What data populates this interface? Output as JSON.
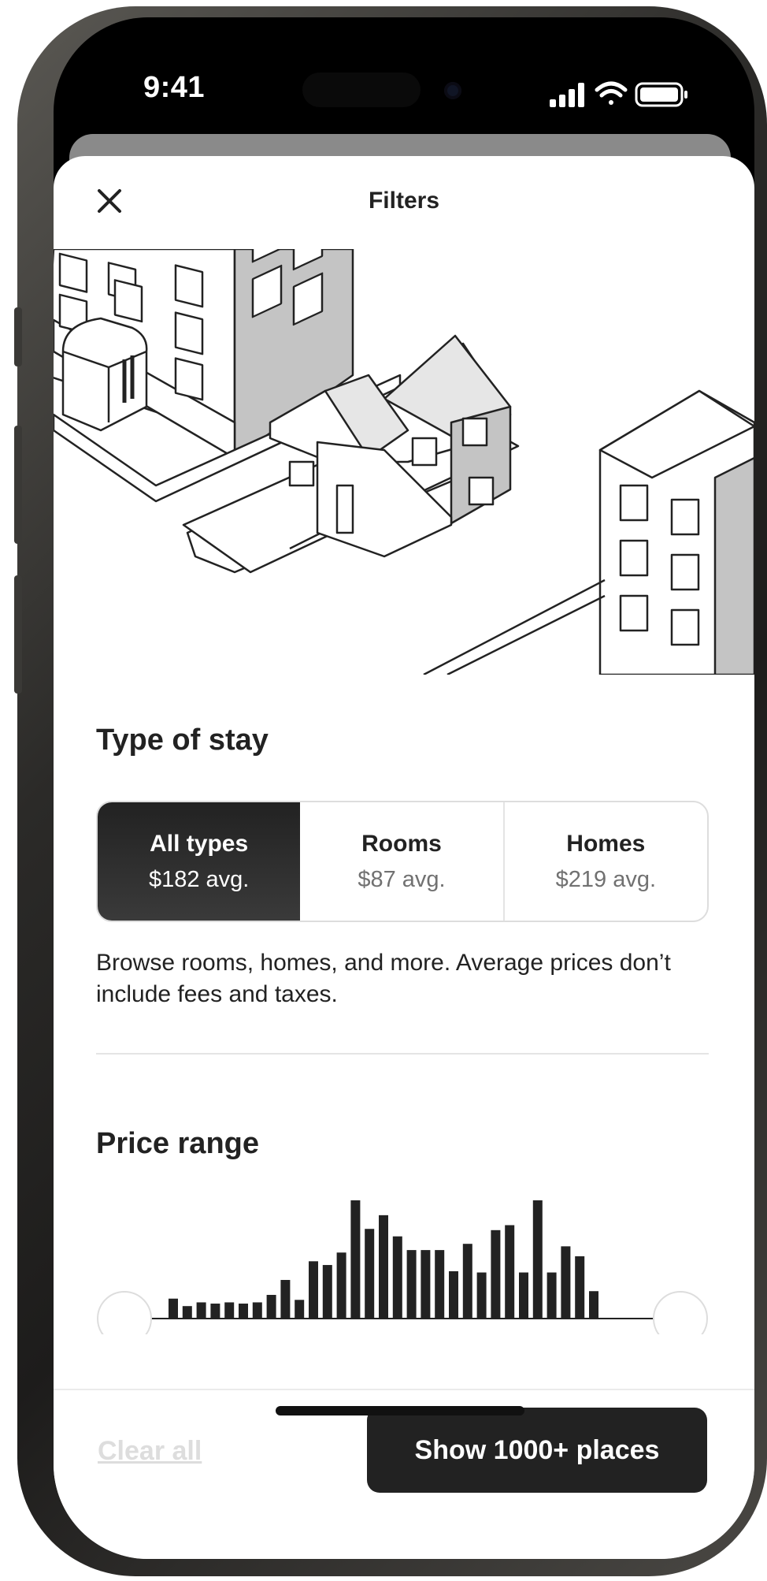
{
  "status_bar": {
    "time": "9:41",
    "icons": [
      "cellular-signal-icon",
      "wifi-icon",
      "battery-icon"
    ]
  },
  "header": {
    "title": "Filters",
    "close_icon": "close-icon"
  },
  "type_of_stay": {
    "title": "Type of stay",
    "options": [
      {
        "label": "All types",
        "price": "$182 avg.",
        "selected": true
      },
      {
        "label": "Rooms",
        "price": "$87 avg.",
        "selected": false
      },
      {
        "label": "Homes",
        "price": "$219 avg.",
        "selected": false
      }
    ],
    "description": "Browse rooms, homes, and more. Average prices don’t include fees and taxes."
  },
  "price_range": {
    "title": "Price range",
    "histogram_levels": [
      0.16,
      0.1,
      0.13,
      0.12,
      0.13,
      0.12,
      0.13,
      0.19,
      0.31,
      0.15,
      0.46,
      0.43,
      0.53,
      0.95,
      0.72,
      0.83,
      0.66,
      0.55,
      0.55,
      0.55,
      0.38,
      0.6,
      0.37,
      0.71,
      0.75,
      0.37,
      1.0,
      0.37,
      0.58,
      0.5,
      0.22
    ],
    "slider_min_fraction": 0,
    "slider_max_fraction": 1
  },
  "footer": {
    "clear_label": "Clear all",
    "show_label": "Show 1000+ places"
  },
  "colors": {
    "primary": "#222222",
    "muted": "#717171",
    "border": "#dddddd",
    "disabled": "#dddddd"
  }
}
